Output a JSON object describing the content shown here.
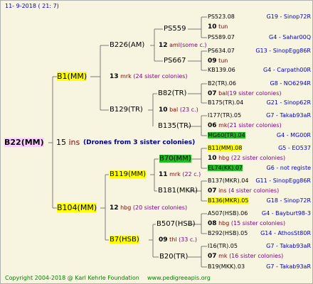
{
  "header": {
    "date_code": "11-   9-2018 (  21:   7)"
  },
  "footer": {
    "copyright": "Copyright 2004-2018 @ Karl Kehrle Foundation",
    "website": "www.pedigreeapis.org"
  },
  "root": {
    "label": "B22(MM)",
    "count": "15",
    "race": "ins",
    "note": "(Drones from 3 sister colonies)"
  },
  "gen1": [
    {
      "label": "B1(MM)",
      "count": "13",
      "race": "mrk",
      "sister_note": "(24 sister colonies)"
    },
    {
      "label": "B104(MM)",
      "count": "12",
      "race": "hbg",
      "sister_note": "(20 sister colonies)"
    }
  ],
  "gen2": [
    {
      "label": "B226(AM)",
      "count": "12",
      "race": "aml",
      "sister_note": "(some c.)"
    },
    {
      "label": "B129(TR)",
      "count": "10",
      "race": "bal",
      "sister_note": "(23 c.)"
    },
    {
      "label": "B119(MM)",
      "count": "11",
      "race": "mrk",
      "sister_note": "(22 c.)"
    },
    {
      "label": "B7(HSB)",
      "count": "09",
      "race": "thl",
      "sister_note": "(33 c.)"
    }
  ],
  "gen3": [
    {
      "label": "PS559"
    },
    {
      "label": "PS667"
    },
    {
      "label": "B82(TR)"
    },
    {
      "label": "B135(TR)"
    },
    {
      "label": "B70(MM)"
    },
    {
      "label": "B181(MKR)"
    },
    {
      "label": "B507(HSB)"
    },
    {
      "label": "B20(TR)"
    }
  ],
  "gen4_groups": [
    {
      "top": "PS523.08",
      "count": "10",
      "race": "tun",
      "note": "",
      "bottom": "PS589.07"
    },
    {
      "top": "PS634.07",
      "count": "09",
      "race": "tun",
      "note": "",
      "bottom": "KB139.06"
    },
    {
      "top": "B2(TR).06",
      "count": "07",
      "race": "bal",
      "note": "(19 sister colonies)",
      "bottom": "B175(TR).04"
    },
    {
      "top": "I177(TR).05",
      "count": "06",
      "race": "mk",
      "note": "(21 sister colonies)",
      "bottom": "MG60(TR).04"
    },
    {
      "top": "B11(MM).08",
      "count": "10",
      "race": "hbg",
      "note": "(22 sister colonies)",
      "bottom": "EL74(KK).07"
    },
    {
      "top": "B137(MKR).04",
      "count": "07",
      "race": "ins",
      "note": "(4 sister colonies)",
      "bottom": "B136(MKR).05"
    },
    {
      "top": "A507(HSB).06",
      "count": "08",
      "race": "hbg",
      "note": "(15 sister colonies)",
      "bottom": "B292(HSB).05"
    },
    {
      "top": "I16(TR).05",
      "count": "07",
      "race": "mk",
      "note": "(16 sister colonies)",
      "bottom": "B19(MKK).03"
    }
  ],
  "gen5": [
    "G19 - Sinop72R",
    "G4 - Sahar00Q",
    "G13 - SinopEgg86R",
    "G4 - Carpath00R",
    "G8 - NO6294R",
    "G21 - Sinop62R",
    "G7 - Takab93aR",
    "G4 - MG00R",
    "G5 - EO537",
    "G6 - not registe",
    "G11 - SinopEgg86R",
    "G18 - Sinop72R",
    "G4 - Bayburt98-3",
    "G14 - AthosSt80R",
    "G7 - Takab93aR",
    "G7 - Takab93aR"
  ]
}
